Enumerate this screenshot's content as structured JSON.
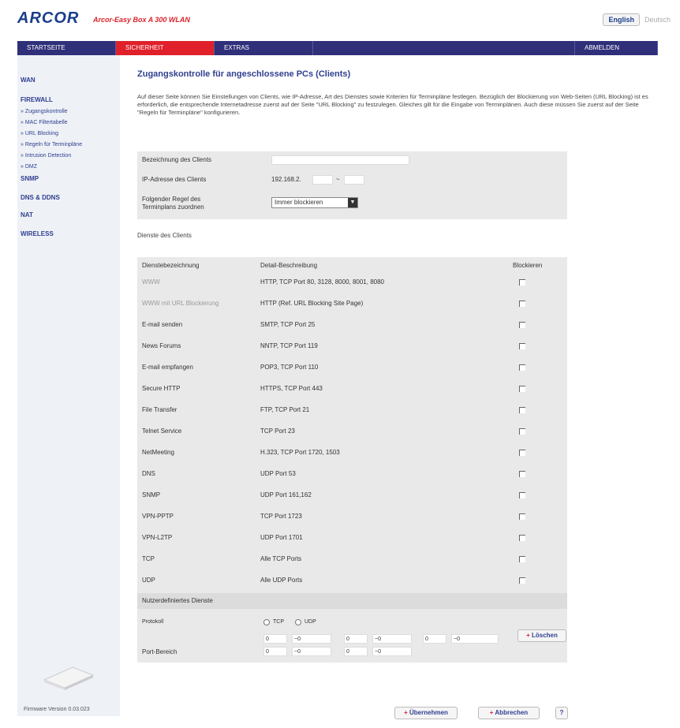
{
  "header": {
    "logo": "ARCOR",
    "subtitle": "Arcor-Easy Box A 300 WLAN",
    "lang_active": "English",
    "lang_other": "Deutsch"
  },
  "nav": {
    "items": [
      "STARTSEITE",
      "SICHERHEIT",
      "EXTRAS",
      "ABMELDEN"
    ],
    "active": "SICHERHEIT"
  },
  "sidebar": {
    "items": [
      "WAN",
      "FIREWALL",
      "Zugangskontrolle",
      "MAC Filtertabelle",
      "URL Blocking",
      "Regeln für Terminpläne",
      "Intrusion Detection",
      "DMZ",
      "SNMP",
      "DNS & DDNS",
      "NAT",
      "WIRELESS"
    ],
    "firmware": "Firmware Version 0.03.023"
  },
  "main": {
    "title": "Zugangskontrolle für angeschlossene PCs (Clients)",
    "intro": "Auf dieser Seite können Sie Einstellungen von Clients, wie IP-Adresse, Art des Dienstes sowie Kriterien für Terminpläne festlegen. Bezüglich der Blockierung von Web-Seiten (URL Blocking) ist es erforderlich, die entsprechende Internetadresse zuerst auf der Seite \"URL Blocking\" zu festzulegen. Gleiches gilt für die Eingabe von Terminplänen. Auch diese müssen Sie zuerst auf der Seite \"Regeln für Terminpläne\" konfigurieren.",
    "form": {
      "label_name": "Bezeichnung des Clients",
      "name_value": "",
      "label_ip": "IP-Adresse des Clients",
      "ip_prefix": "192.168.2.",
      "ip_sep": "~",
      "label_rule": "Folgender Regel des Terminplans zuordnen",
      "rule_value": "Immer blockieren"
    },
    "services_label": "Dienste des Clients",
    "services_headers": [
      "Dienstebezeichnung",
      "Detail-Beschreibung",
      "Blockieren"
    ],
    "services": [
      {
        "name": "WWW",
        "desc": "HTTP, TCP Port 80, 3128, 8000, 8001, 8080"
      },
      {
        "name": "WWW mit URL Blockierung",
        "desc": "HTTP (Ref. URL Blocking Site Page)"
      },
      {
        "name": "E-mail senden",
        "desc": "SMTP, TCP Port 25"
      },
      {
        "name": "News Forums",
        "desc": "NNTP, TCP Port 119"
      },
      {
        "name": "E-mail empfangen",
        "desc": "POP3, TCP Port 110"
      },
      {
        "name": "Secure HTTP",
        "desc": "HTTPS, TCP Port 443"
      },
      {
        "name": "File Transfer",
        "desc": "FTP, TCP Port 21"
      },
      {
        "name": "Telnet Service",
        "desc": "TCP Port 23"
      },
      {
        "name": "NetMeeting",
        "desc": "H.323, TCP Port 1720, 1503"
      },
      {
        "name": "DNS",
        "desc": "UDP Port 53"
      },
      {
        "name": "SNMP",
        "desc": "UDP Port 161,162"
      },
      {
        "name": "VPN-PPTP",
        "desc": "TCP Port 1723"
      },
      {
        "name": "VPN-L2TP",
        "desc": "UDP Port 1701"
      },
      {
        "name": "TCP",
        "desc": "Alle TCP Ports"
      },
      {
        "name": "UDP",
        "desc": "Alle UDP Ports"
      }
    ],
    "custom": {
      "header": "Nutzerdefiniertes Dienste",
      "protocol_label": "Protokoll",
      "tcp_label": "TCP",
      "udp_label": "UDP",
      "port_label": "Port-Bereich",
      "port_from": "0",
      "port_to": "~0",
      "delete_label": "Löschen"
    },
    "buttons": {
      "apply": "Übernehmen",
      "cancel": "Abbrechen",
      "help": "?"
    }
  }
}
